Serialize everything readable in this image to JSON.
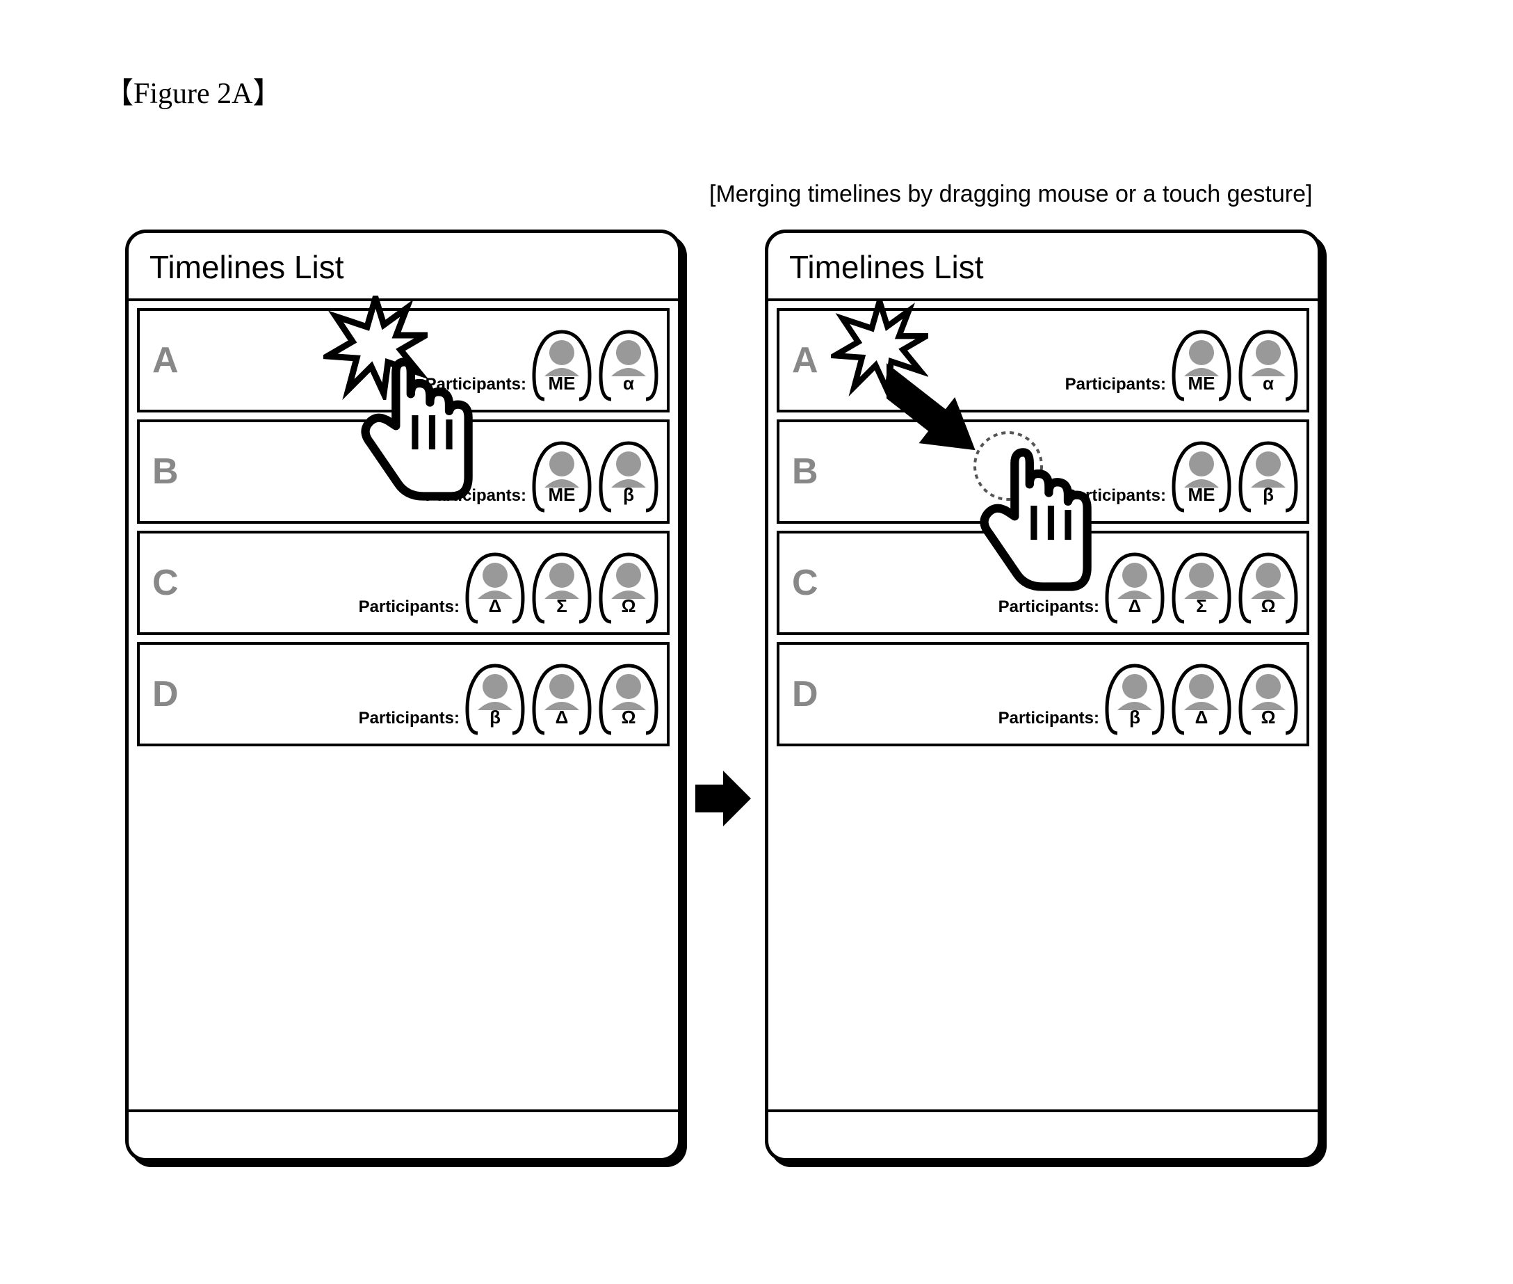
{
  "figure_label": "【Figure 2A】",
  "caption": "[Merging timelines by dragging mouse or a touch gesture]",
  "panel_title": "Timelines List",
  "participants_label": "Participants:",
  "panels": [
    {
      "rows": [
        {
          "letter": "A",
          "participants": [
            "ME",
            "α"
          ]
        },
        {
          "letter": "B",
          "participants": [
            "ME",
            "β"
          ]
        },
        {
          "letter": "C",
          "participants": [
            "Δ",
            "Σ",
            "Ω"
          ]
        },
        {
          "letter": "D",
          "participants": [
            "β",
            "Δ",
            "Ω"
          ]
        }
      ],
      "gesture": {
        "type": "touch-start",
        "row": "A"
      }
    },
    {
      "rows": [
        {
          "letter": "A",
          "participants": [
            "ME",
            "α"
          ]
        },
        {
          "letter": "B",
          "participants": [
            "ME",
            "β"
          ]
        },
        {
          "letter": "C",
          "participants": [
            "Δ",
            "Σ",
            "Ω"
          ]
        },
        {
          "letter": "D",
          "participants": [
            "β",
            "Δ",
            "Ω"
          ]
        }
      ],
      "gesture": {
        "type": "drag",
        "from_row": "A",
        "to_row": "B"
      }
    }
  ]
}
